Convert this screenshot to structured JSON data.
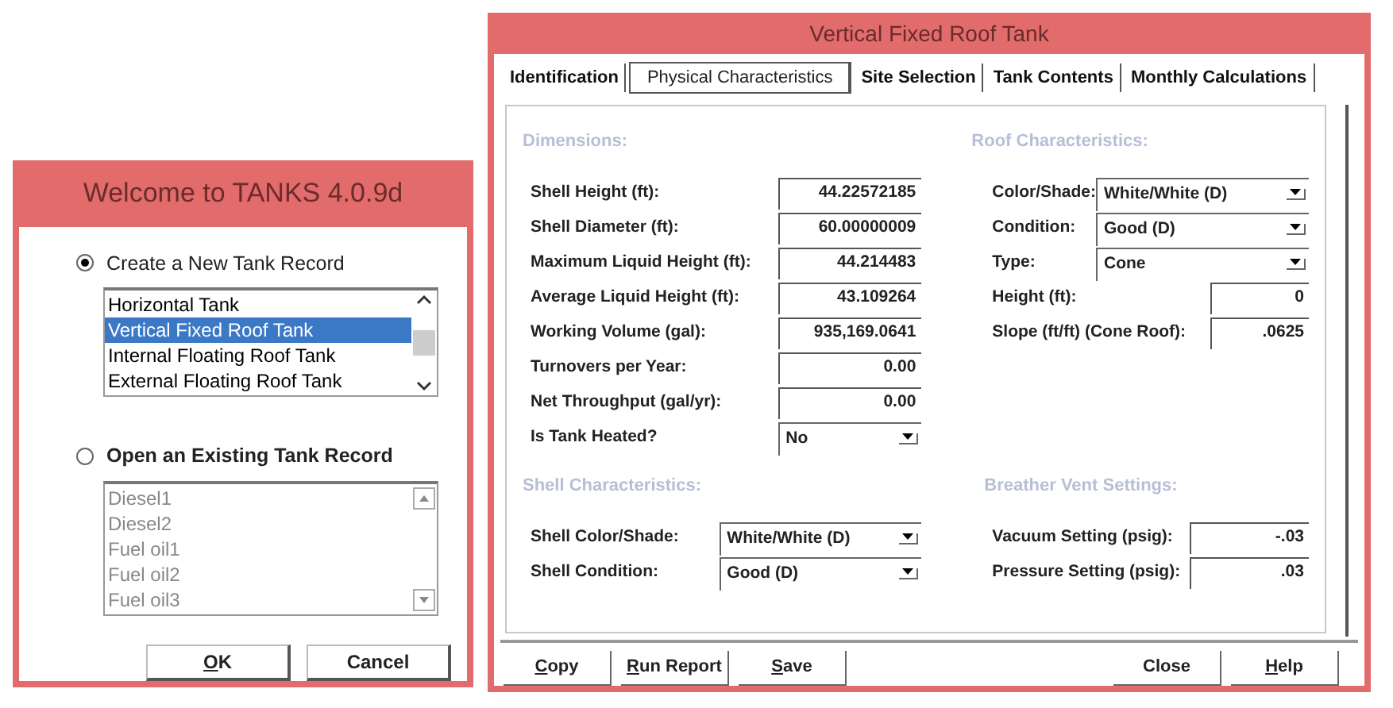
{
  "welcome_window": {
    "title": "Welcome to TANKS 4.0.9d",
    "options": [
      {
        "label": "Create a New Tank Record",
        "selected": true,
        "list_disabled": false,
        "items": [
          {
            "label": "Horizontal Tank",
            "selected": false
          },
          {
            "label": "Vertical Fixed Roof Tank",
            "selected": true
          },
          {
            "label": "Internal Floating Roof Tank",
            "selected": false
          },
          {
            "label": "External Floating Roof Tank",
            "selected": false
          }
        ]
      },
      {
        "label": "Open an Existing Tank Record",
        "selected": false,
        "list_disabled": true,
        "items": [
          {
            "label": "Diesel1",
            "selected": false
          },
          {
            "label": "Diesel2",
            "selected": false
          },
          {
            "label": "Fuel oil1",
            "selected": false
          },
          {
            "label": "Fuel oil2",
            "selected": false
          },
          {
            "label": "Fuel oil3",
            "selected": false
          }
        ]
      }
    ],
    "buttons": [
      {
        "label": "OK",
        "mnemonic": true
      },
      {
        "label": "Cancel",
        "mnemonic": false
      }
    ]
  },
  "tank_window": {
    "title": "Vertical Fixed Roof Tank",
    "tabs": [
      {
        "label": "Identification",
        "selected": false
      },
      {
        "label": "Physical Characteristics",
        "selected": true
      },
      {
        "label": "Site Selection",
        "selected": false
      },
      {
        "label": "Tank Contents",
        "selected": false
      },
      {
        "label": "Monthly Calculations",
        "selected": false
      }
    ],
    "left_column": [
      {
        "title": "Dimensions:",
        "fields": [
          {
            "label": "Shell Height (ft):",
            "kind": "input",
            "value": "44.22572185"
          },
          {
            "label": "Shell Diameter (ft):",
            "kind": "input",
            "value": "60.00000009"
          },
          {
            "label": "Maximum Liquid Height (ft):",
            "kind": "input",
            "value": "44.214483"
          },
          {
            "label": "Average Liquid Height (ft):",
            "kind": "input",
            "value": "43.109264"
          },
          {
            "label": "Working Volume (gal):",
            "kind": "input",
            "value": "935,169.0641"
          },
          {
            "label": "Turnovers per Year:",
            "kind": "input",
            "value": "0.00"
          },
          {
            "label": "Net Throughput (gal/yr):",
            "kind": "input",
            "value": "0.00"
          },
          {
            "label": "Is Tank Heated?",
            "kind": "select",
            "value": "No"
          }
        ]
      },
      {
        "title": "Shell Characteristics:",
        "fields": [
          {
            "label": "Shell Color/Shade:",
            "kind": "select",
            "value": "White/White (D)"
          },
          {
            "label": "Shell Condition:",
            "kind": "select",
            "value": "Good (D)"
          }
        ]
      }
    ],
    "right_column": [
      {
        "title": "Roof Characteristics:",
        "fields": [
          {
            "label": "Color/Shade:",
            "kind": "select",
            "value": "White/White (D)"
          },
          {
            "label": "Condition:",
            "kind": "select",
            "value": "Good (D)"
          },
          {
            "label": "Type:",
            "kind": "select",
            "value": "Cone"
          },
          {
            "label": "Height (ft):",
            "kind": "input",
            "value": "0"
          },
          {
            "label": "Slope (ft/ft) (Cone Roof):",
            "kind": "input",
            "value": ".0625"
          }
        ]
      },
      {
        "title": "Breather Vent Settings:",
        "fields": [
          {
            "label": "Vacuum Setting (psig):",
            "kind": "input",
            "value": "-.03"
          },
          {
            "label": "Pressure Setting (psig):",
            "kind": "input",
            "value": ".03"
          }
        ]
      }
    ],
    "buttons_left": [
      {
        "label": "Copy",
        "mnemonic": true
      },
      {
        "label": "Run Report",
        "mnemonic": true
      },
      {
        "label": "Save",
        "mnemonic": true
      }
    ],
    "buttons_right": [
      {
        "label": "Close",
        "mnemonic": false
      },
      {
        "label": "Help",
        "mnemonic": true
      }
    ]
  }
}
